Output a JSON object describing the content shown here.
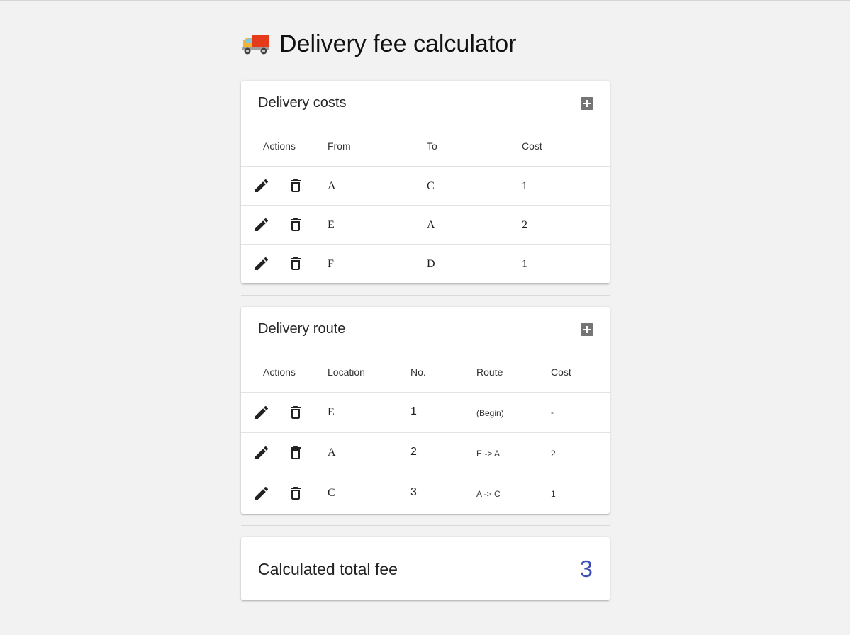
{
  "header": {
    "title": "Delivery fee calculator",
    "logo_icon": "delivery-truck-icon"
  },
  "costs": {
    "title": "Delivery costs",
    "columns": [
      "Actions",
      "From",
      "To",
      "Cost"
    ],
    "rows": [
      {
        "from": "A",
        "to": "C",
        "cost": "1"
      },
      {
        "from": "E",
        "to": "A",
        "cost": "2"
      },
      {
        "from": "F",
        "to": "D",
        "cost": "1"
      }
    ]
  },
  "route": {
    "title": "Delivery route",
    "columns": [
      "Actions",
      "Location",
      "No.",
      "Route",
      "Cost"
    ],
    "rows": [
      {
        "location": "E",
        "no": "1",
        "route": "(Begin)",
        "cost": "-"
      },
      {
        "location": "A",
        "no": "2",
        "route": "E -> A",
        "cost": "2"
      },
      {
        "location": "C",
        "no": "3",
        "route": "A -> C",
        "cost": "1"
      }
    ]
  },
  "total": {
    "label": "Calculated total fee",
    "value": "3"
  },
  "colors": {
    "accent": "#3f51b5",
    "icon_gray": "#757575",
    "background": "#f2f2f2"
  }
}
